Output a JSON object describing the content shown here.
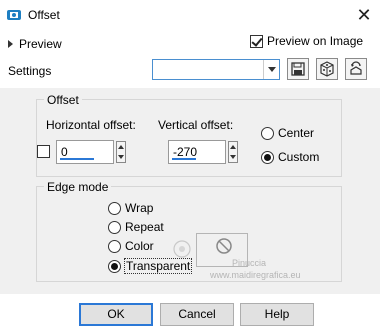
{
  "window": {
    "title": "Offset",
    "close_glyph": "✕"
  },
  "preview": {
    "label": "Preview",
    "preview_on_image_label": "Preview on Image",
    "preview_on_image_checked": true
  },
  "settings": {
    "label": "Settings",
    "value": ""
  },
  "offset_group": {
    "title": "Offset",
    "horizontal": {
      "label": "Horizontal offset:",
      "value": "0"
    },
    "vertical": {
      "label": "Vertical offset:",
      "value": "-270"
    },
    "link_checked": false,
    "origin": {
      "options": [
        "Center",
        "Custom"
      ],
      "selected": "Custom"
    }
  },
  "edge_group": {
    "title": "Edge mode",
    "options": [
      "Wrap",
      "Repeat",
      "Color",
      "Transparent"
    ],
    "selected": "Transparent"
  },
  "buttons": {
    "ok": "OK",
    "cancel": "Cancel",
    "help": "Help"
  },
  "watermark": {
    "line1": "Pinuccia",
    "line2": "www.maidiregrafica.eu"
  },
  "colors": {
    "accent": "#2b78d6",
    "panel": "#f0f0f0"
  }
}
